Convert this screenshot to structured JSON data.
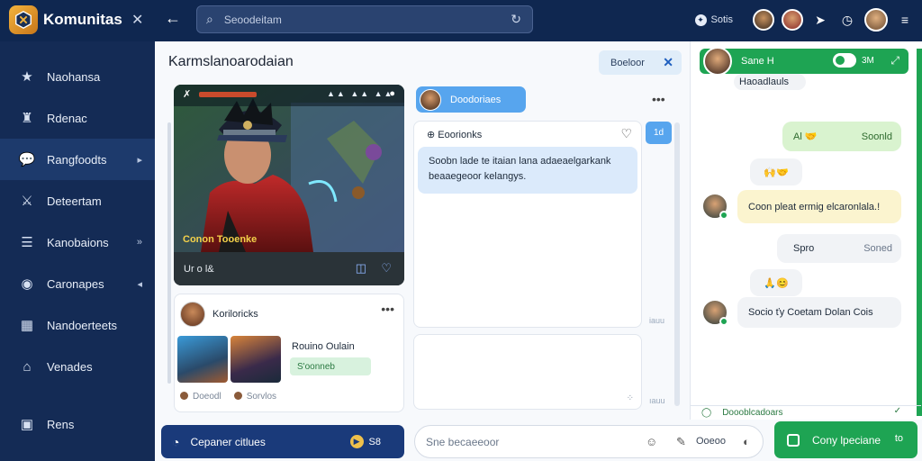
{
  "app": {
    "name": "Komunitas",
    "close_icon": "close-icon",
    "back_icon": "arrow-left-icon"
  },
  "search": {
    "placeholder": "Seoodeitam"
  },
  "topbar": {
    "status_label": "Sotis",
    "status_glyph": "≡"
  },
  "sidebar": {
    "items": [
      {
        "label": "Naohansa",
        "icon": "star-badge-icon",
        "arrow": ""
      },
      {
        "label": "Rdenac",
        "icon": "castle-icon",
        "arrow": ""
      },
      {
        "label": "Rangfoodts",
        "icon": "chat-icon",
        "arrow": "▸"
      },
      {
        "label": "Deteertam",
        "icon": "swords-icon",
        "arrow": ""
      },
      {
        "label": "Kanobaions",
        "icon": "list-icon",
        "arrow": "»"
      },
      {
        "label": "Caronapes",
        "icon": "globe-icon",
        "arrow": "◂"
      },
      {
        "label": "Nandoerteets",
        "icon": "grid-icon",
        "arrow": ""
      },
      {
        "label": "Venades",
        "icon": "shop-icon",
        "arrow": ""
      },
      {
        "label": "Rens",
        "icon": "bag-icon",
        "arrow": ""
      }
    ]
  },
  "main": {
    "title": "Karmslanoarodaian",
    "button_label": "Boeloor",
    "game": {
      "overlay_text": "Conon Tooenke",
      "footer_text": "Ur o l&",
      "stats_text": "▲▲ ▲▲ ▲▲"
    },
    "post": {
      "author": "Koriloricks",
      "name": "Rouino Oulain",
      "badge": "S'oonneb",
      "foot1": "Doeodl",
      "foot2": "Sorvlos"
    },
    "thread": {
      "chip_label": "Doodoriaes",
      "title": "Eoorionks",
      "bubble_line1": "Soobn lade te itaian lana adaeaelgarkank",
      "bubble_line2": "beaaegeoor kelangys.",
      "side_badge": "1d",
      "scroll_label1": "iauu",
      "scroll_label2": "ıauu"
    }
  },
  "bottom": {
    "primary_label": "Cepaner citlues",
    "primary_count": "S8",
    "input_placeholder": "Sne becaeeoor",
    "input_label": "Ooeoo",
    "green_label": "Cony lpeciane",
    "green_count": "to"
  },
  "chat": {
    "header_name": "Sane H",
    "header_count": "3M",
    "messages": [
      {
        "text": "Haoadlauls",
        "side": "in"
      },
      {
        "text": "Al 🤝",
        "side": "out",
        "meta": "Soonld"
      },
      {
        "text": "🙌🤝",
        "side": "in"
      },
      {
        "text": "Coon pleat ermig elcaronlala.!",
        "side": "yel"
      },
      {
        "text": "Spro",
        "side": "in",
        "meta": "Soned"
      },
      {
        "text": "🙏😊",
        "side": "in"
      },
      {
        "text": "Socio ťy Coetam Dolan Cois",
        "side": "in"
      }
    ],
    "footer_label": "Doooblcadoars"
  },
  "colors": {
    "navy": "#0f2750",
    "sidebar": "#142b55",
    "accent_blue": "#57a5ee",
    "green": "#1ea453"
  }
}
